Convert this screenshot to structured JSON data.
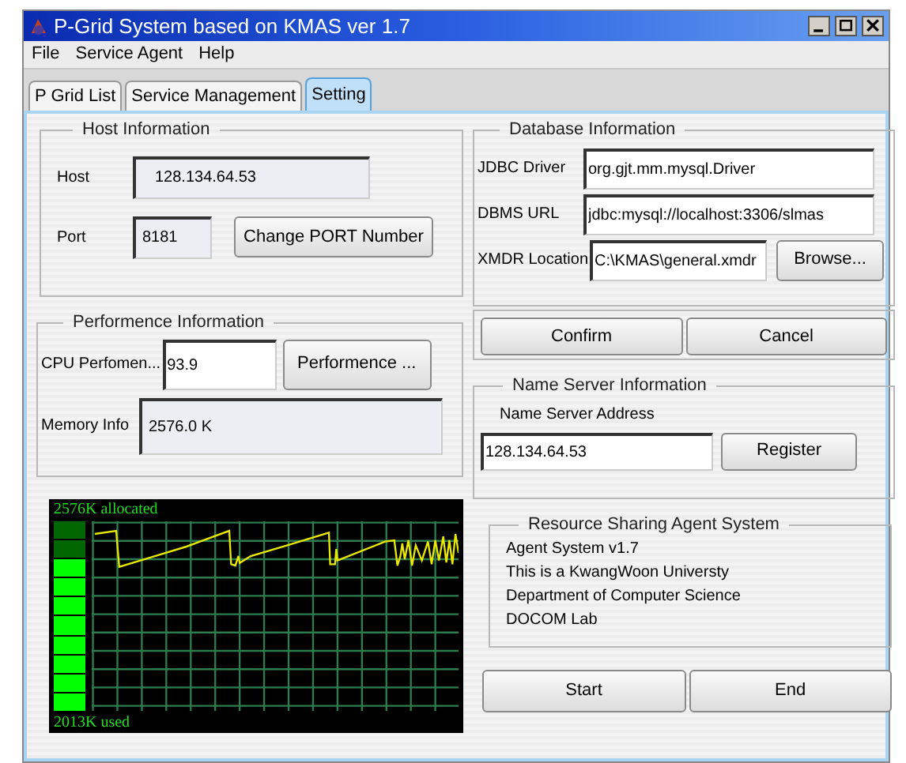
{
  "window": {
    "title": "P-Grid System based on KMAS ver 1.7"
  },
  "menu": [
    {
      "label": "File"
    },
    {
      "label": "Service Agent"
    },
    {
      "label": "Help"
    }
  ],
  "tabs": [
    {
      "label": "P Grid List",
      "selected": false
    },
    {
      "label": "Service Management",
      "selected": false
    },
    {
      "label": "Setting",
      "selected": true
    }
  ],
  "host_information": {
    "title": "Host Information",
    "host_label": "Host",
    "host_value": "128.134.64.53",
    "port_label": "Port",
    "port_value": "8181",
    "change_button": "Change PORT Number"
  },
  "performance_information": {
    "title": "Performence Information",
    "cpu_label": "CPU Perfomen...",
    "cpu_value": "93.9",
    "performance_button": "Performence ...",
    "memory_label": "Memory Info",
    "memory_value": "2576.0 K"
  },
  "memory_monitor": {
    "allocated": "2576K allocated",
    "used": "2013K used",
    "level": 0.8
  },
  "database_information": {
    "title": "Database Information",
    "fields": [
      {
        "label": "JDBC Driver",
        "value": "org.gjt.mm.mysql.Driver"
      },
      {
        "label": "DBMS URL",
        "value": "jdbc:mysql://localhost:3306/slmas"
      },
      {
        "label": "XMDR Location",
        "value": "C:\\KMAS\\general.xmdr",
        "button": "Browse..."
      }
    ]
  },
  "database_buttons": [
    "Confirm",
    "Cancel"
  ],
  "name_server": {
    "title": "Name Server Information",
    "address_label": "Name Server Address",
    "address_value": "128.134.64.53",
    "register_button": "Register"
  },
  "resource_sharing": {
    "title": "Resource Sharing Agent System",
    "lines": [
      "Agent System v1.7",
      "This is a KwangWoon Universty",
      "Department of Computer Science",
      "DOCOM Lab"
    ]
  },
  "bottom_buttons": [
    "Start",
    "End"
  ]
}
